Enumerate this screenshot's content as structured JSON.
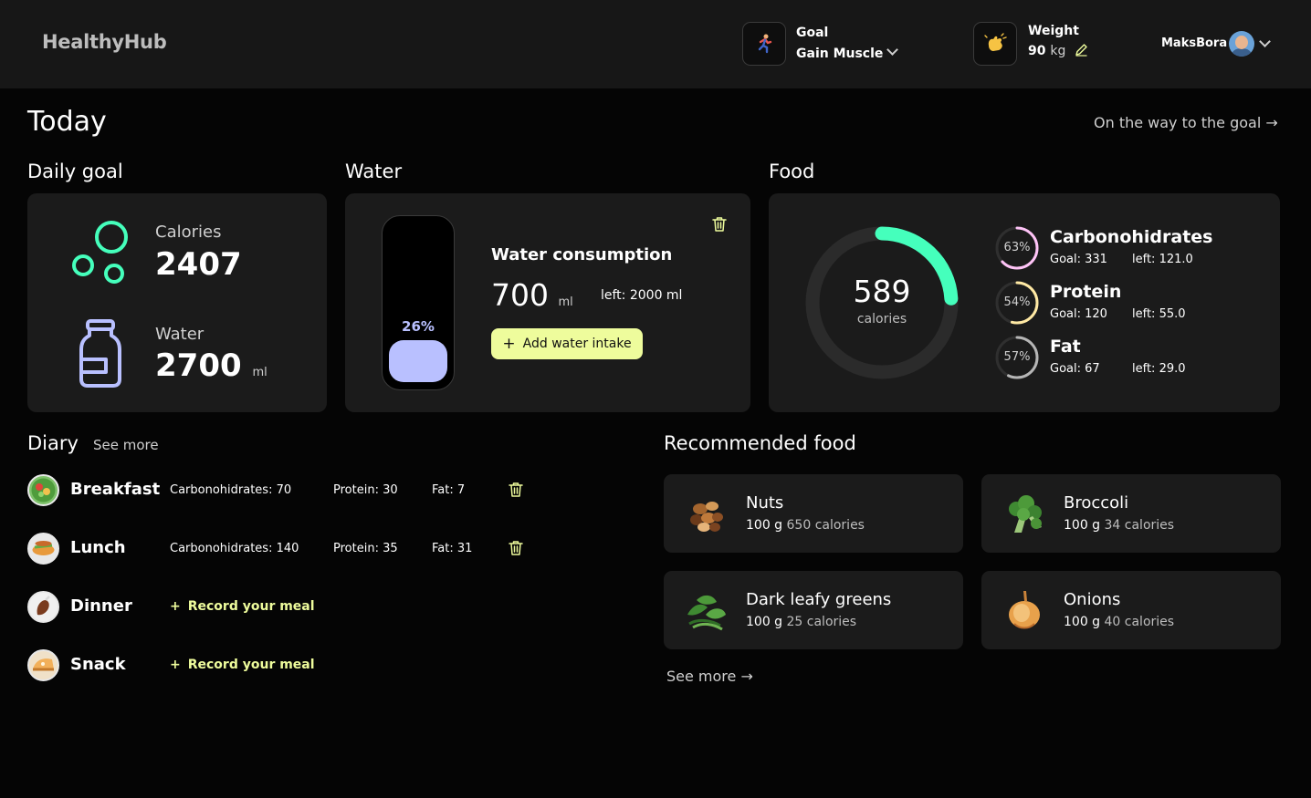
{
  "header": {
    "logo": "HealthyHub",
    "goal_label": "Goal",
    "goal_value": "Gain Muscle",
    "weight_label": "Weight",
    "weight_value": "90",
    "weight_unit": "kg",
    "user_name": "MaksBora"
  },
  "page": {
    "title": "Today",
    "goal_link": "On the way to the goal →"
  },
  "sections": {
    "daily_goal": "Daily goal",
    "water": "Water",
    "food": "Food",
    "diary": "Diary",
    "diary_see_more": "See more",
    "recommended": "Recommended food",
    "recommended_see_more": "See more →"
  },
  "daily_goal": {
    "calories_label": "Calories",
    "calories_value": "2407",
    "water_label": "Water",
    "water_value": "2700",
    "water_unit": "ml"
  },
  "water": {
    "percent_label": "26%",
    "fill_fraction": 0.26,
    "title": "Water consumption",
    "amount": "700",
    "unit": "ml",
    "left": "left: 2000 ml",
    "add_button": "Add water intake",
    "accent": "#b9c0ff"
  },
  "food": {
    "calories": "589",
    "calories_label": "calories",
    "progress_fraction": 0.24,
    "accent": "#45ffbc",
    "macros": [
      {
        "percent": "63%",
        "fraction": 0.63,
        "name": "Carbonohidrates",
        "goal": "Goal: 331",
        "left": "left: 121.0",
        "color": "#ffc4f7"
      },
      {
        "percent": "54%",
        "fraction": 0.54,
        "name": "Protein",
        "goal": "Goal: 120",
        "left": "left: 55.0",
        "color": "#ffe9a4"
      },
      {
        "percent": "57%",
        "fraction": 0.57,
        "name": "Fat",
        "goal": "Goal: 67",
        "left": "left: 29.0",
        "color": "#b6b6b6"
      }
    ]
  },
  "diary": {
    "meals": [
      {
        "name": "Breakfast",
        "carbs": "Carbonohidrates: 70",
        "protein": "Protein: 30",
        "fat": "Fat: 7"
      },
      {
        "name": "Lunch",
        "carbs": "Carbonohidrates: 140",
        "protein": "Protein: 35",
        "fat": "Fat: 31"
      },
      {
        "name": "Dinner",
        "record": "Record your meal"
      },
      {
        "name": "Snack",
        "record": "Record your meal"
      }
    ]
  },
  "recommended": [
    {
      "name": "Nuts",
      "amount": "100 g",
      "calories": "650 calories"
    },
    {
      "name": "Broccoli",
      "amount": "100 g",
      "calories": "34 calories"
    },
    {
      "name": "Dark leafy greens",
      "amount": "100 g",
      "calories": "25 calories"
    },
    {
      "name": "Onions",
      "amount": "100 g",
      "calories": "40 calories"
    }
  ]
}
